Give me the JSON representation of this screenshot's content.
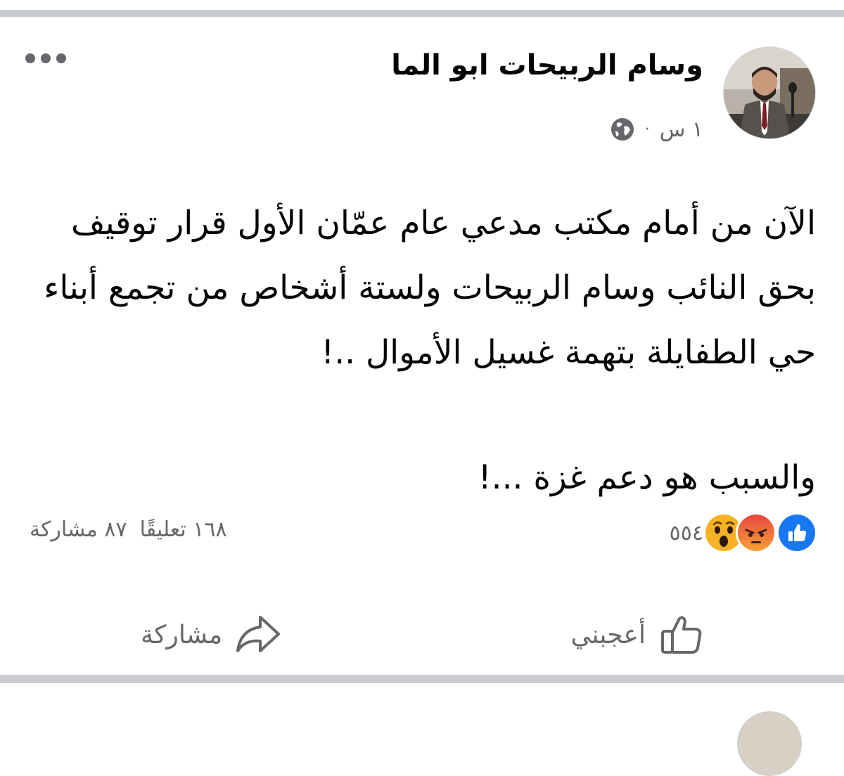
{
  "post": {
    "author_name": "وسام الربيحات ابو الما",
    "timestamp": "١ س",
    "meta_separator": "·",
    "visibility_icon": "globe-icon",
    "more_icon": "more-options-icon",
    "body_lines": [
      "الآن من أمام مكتب مدعي عام عمّان الأول قرار توقيف بحق النائب وسام الربيحات ولستة أشخاص من تجمع أبناء حي الطفايلة بتهمة غسيل الأموال  ..!",
      "والسبب هو دعم غزة ...!"
    ],
    "reactions": {
      "icons": [
        "like-reaction-icon",
        "angry-reaction-icon",
        "wow-reaction-icon"
      ],
      "count": "٥٥٤",
      "colors": {
        "like": "#1877f2",
        "angry": "#e9710f",
        "wow": "#f7b125"
      }
    },
    "comments_count": "١٦٨ تعليقًا",
    "shares_count": "٨٧ مشاركة",
    "actions": {
      "like_label": "أعجبني",
      "share_label": "مشاركة"
    }
  },
  "colors": {
    "separator": "#c9ccd1",
    "secondary_text": "#65676b",
    "primary_text": "#050505"
  }
}
